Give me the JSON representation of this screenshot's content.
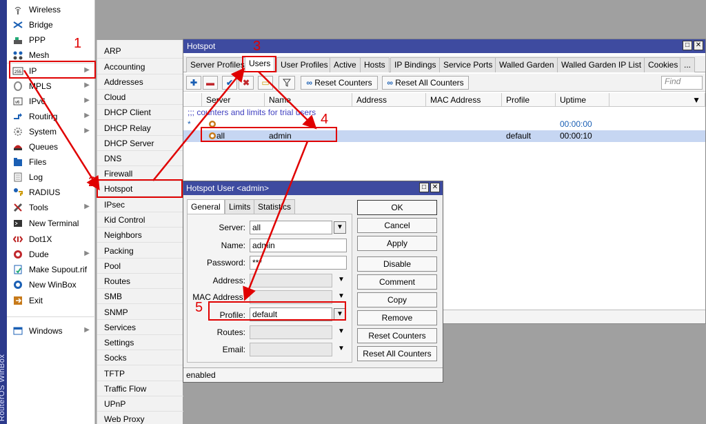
{
  "brand": {
    "strip_text": "RouterOS WinBox"
  },
  "main_menu": {
    "items": [
      {
        "label": "Wireless",
        "icon": "wireless-icon"
      },
      {
        "label": "Bridge",
        "icon": "bridge-icon"
      },
      {
        "label": "PPP",
        "icon": "ppp-icon"
      },
      {
        "label": "Mesh",
        "icon": "mesh-icon"
      },
      {
        "label": "IP",
        "icon": "ip-icon",
        "submenu": true
      },
      {
        "label": "MPLS",
        "icon": "mpls-icon",
        "submenu": true
      },
      {
        "label": "IPv6",
        "icon": "ipv6-icon",
        "submenu": true
      },
      {
        "label": "Routing",
        "icon": "routing-icon",
        "submenu": true
      },
      {
        "label": "System",
        "icon": "system-icon",
        "submenu": true
      },
      {
        "label": "Queues",
        "icon": "queues-icon"
      },
      {
        "label": "Files",
        "icon": "files-icon"
      },
      {
        "label": "Log",
        "icon": "log-icon"
      },
      {
        "label": "RADIUS",
        "icon": "radius-icon"
      },
      {
        "label": "Tools",
        "icon": "tools-icon",
        "submenu": true
      },
      {
        "label": "New Terminal",
        "icon": "terminal-icon"
      },
      {
        "label": "Dot1X",
        "icon": "dot1x-icon"
      },
      {
        "label": "Dude",
        "icon": "dude-icon",
        "submenu": true
      },
      {
        "label": "Make Supout.rif",
        "icon": "supout-icon"
      },
      {
        "label": "New WinBox",
        "icon": "winbox-icon"
      },
      {
        "label": "Exit",
        "icon": "exit-icon"
      },
      {
        "label": "Windows",
        "icon": "windows-icon",
        "submenu": true
      }
    ]
  },
  "ip_submenu": {
    "items": [
      "ARP",
      "Accounting",
      "Addresses",
      "Cloud",
      "DHCP Client",
      "DHCP Relay",
      "DHCP Server",
      "DNS",
      "Firewall",
      "Hotspot",
      "IPsec",
      "Kid Control",
      "Neighbors",
      "Packing",
      "Pool",
      "Routes",
      "SMB",
      "SNMP",
      "Services",
      "Settings",
      "Socks",
      "TFTP",
      "Traffic Flow",
      "UPnP",
      "Web Proxy"
    ]
  },
  "hotspot_window": {
    "title": "Hotspot",
    "tabs": [
      "Server Profiles",
      "Users",
      "User Profiles",
      "Active",
      "Hosts",
      "IP Bindings",
      "Service Ports",
      "Walled Garden",
      "Walled Garden IP List",
      "Cookies",
      "..."
    ],
    "active_tab": "Users",
    "toolbar": {
      "reset_counters": "Reset Counters",
      "reset_all_counters": "Reset All Counters",
      "find_placeholder": "Find"
    },
    "columns": [
      "Server",
      "Name",
      "Address",
      "MAC Address",
      "Profile",
      "Uptime"
    ],
    "comment_row": ";;; counters and limits for trial users",
    "rows": [
      {
        "flag": "*",
        "server": "",
        "name": "",
        "address": "",
        "mac": "",
        "profile": "",
        "uptime": "00:00:00"
      },
      {
        "flag": "",
        "server": "all",
        "name": "admin",
        "address": "",
        "mac": "",
        "profile": "default",
        "uptime": "00:00:10"
      }
    ]
  },
  "user_dialog": {
    "title": "Hotspot User <admin>",
    "tabs": [
      "General",
      "Limits",
      "Statistics"
    ],
    "fields": {
      "server_label": "Server:",
      "server_value": "all",
      "name_label": "Name:",
      "name_value": "admin",
      "password_label": "Password:",
      "password_value": "***",
      "address_label": "Address:",
      "mac_label": "MAC Address:",
      "profile_label": "Profile:",
      "profile_value": "default",
      "routes_label": "Routes:",
      "email_label": "Email:"
    },
    "buttons": [
      "OK",
      "Cancel",
      "Apply",
      "Disable",
      "Comment",
      "Copy",
      "Remove",
      "Reset Counters",
      "Reset All Counters"
    ],
    "status": "enabled"
  },
  "annotations": {
    "numbers": [
      "1",
      "2",
      "3",
      "4",
      "5"
    ],
    "color": "#e00000"
  }
}
